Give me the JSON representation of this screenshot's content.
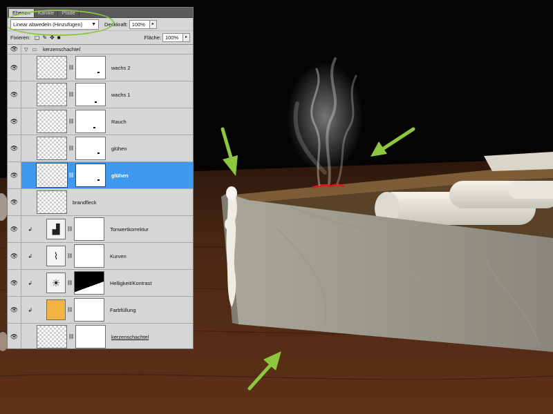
{
  "panel": {
    "tabs": [
      "Ebenen",
      "Kanäle",
      "Pfade"
    ],
    "blend_mode": "Linear abwedeln (Hinzufügen)",
    "opacity_label": "Deckkraft:",
    "opacity_value": "100%",
    "lock_label": "Fixieren:",
    "fill_label": "Fläche:",
    "fill_value": "100%",
    "group_name": "kerzenschachtel",
    "layers": [
      {
        "name": "wachs 2"
      },
      {
        "name": "wachs 1"
      },
      {
        "name": "Rauch"
      },
      {
        "name": "glühen"
      },
      {
        "name": "glühen",
        "selected": true
      },
      {
        "name": "brandfleck"
      },
      {
        "name": "Tonwertkorrektur",
        "icon": "levels-icon"
      },
      {
        "name": "Kurven",
        "icon": "curves-icon"
      },
      {
        "name": "Helligkeit/Kontrast",
        "icon": "brightness-contrast-icon"
      },
      {
        "name": "Farbfüllung",
        "icon": "color-fill-icon"
      },
      {
        "name": "kerzenschachtel"
      }
    ]
  },
  "colors": {
    "highlight_green": "#8dc63f",
    "selection_blue": "#3f99ee",
    "fill_orange": "#f3b340"
  }
}
